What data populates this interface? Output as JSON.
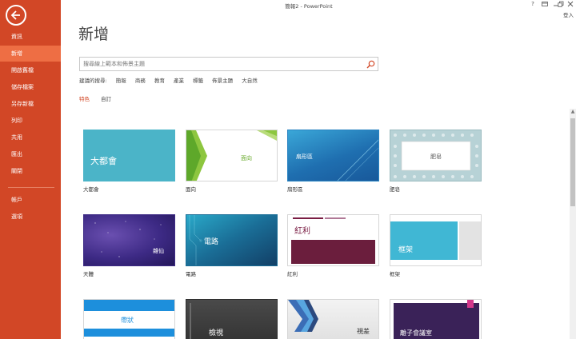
{
  "window": {
    "title": "簡報2 - PowerPoint",
    "help_label": "?",
    "signin_label": "登入"
  },
  "sidebar": {
    "items": [
      {
        "label": "資訊",
        "active": false
      },
      {
        "label": "新增",
        "active": true
      },
      {
        "label": "開啟舊檔",
        "active": false
      },
      {
        "label": "儲存檔案",
        "active": false
      },
      {
        "label": "另存新檔",
        "active": false
      },
      {
        "label": "列印",
        "active": false
      },
      {
        "label": "共用",
        "active": false
      },
      {
        "label": "匯出",
        "active": false
      },
      {
        "label": "關閉",
        "active": false
      },
      {
        "label": "帳戶",
        "active": false
      },
      {
        "label": "選項",
        "active": false
      }
    ]
  },
  "main": {
    "page_title": "新增",
    "search": {
      "value": "",
      "placeholder": "搜尋線上範本和佈景主題"
    },
    "suggested": {
      "label": "建議的搜尋:",
      "items": [
        "簡報",
        "商務",
        "教育",
        "產業",
        "標籤",
        "佈景主題",
        "大自然"
      ]
    },
    "tabs": [
      {
        "label": "特色",
        "selected": true
      },
      {
        "label": "自訂",
        "selected": false
      }
    ]
  },
  "templates": [
    {
      "label": "大都會",
      "thumb_text": "大都會"
    },
    {
      "label": "面向",
      "thumb_text": "面向"
    },
    {
      "label": "扇形區",
      "thumb_text": "扇形區"
    },
    {
      "label": "肥皂",
      "thumb_text": "肥皂"
    },
    {
      "label": "天體",
      "thumb_text": "雜仙"
    },
    {
      "label": "電路",
      "thumb_text": "電路"
    },
    {
      "label": "紅利",
      "thumb_text": "紅利"
    },
    {
      "label": "框架",
      "thumb_text": "框架"
    },
    {
      "label": "",
      "thumb_text": "帶狀"
    },
    {
      "label": "",
      "thumb_text": "檢視"
    },
    {
      "label": "",
      "thumb_text": "視差"
    },
    {
      "label": "",
      "thumb_text": "離子會議室"
    }
  ],
  "colors": {
    "accent": "#d24726",
    "accent_active": "#ee6e44"
  },
  "icons": [
    "back-arrow-icon",
    "search-icon",
    "help-icon",
    "restore-icon",
    "minimize-icon",
    "maximize-icon",
    "close-icon"
  ]
}
